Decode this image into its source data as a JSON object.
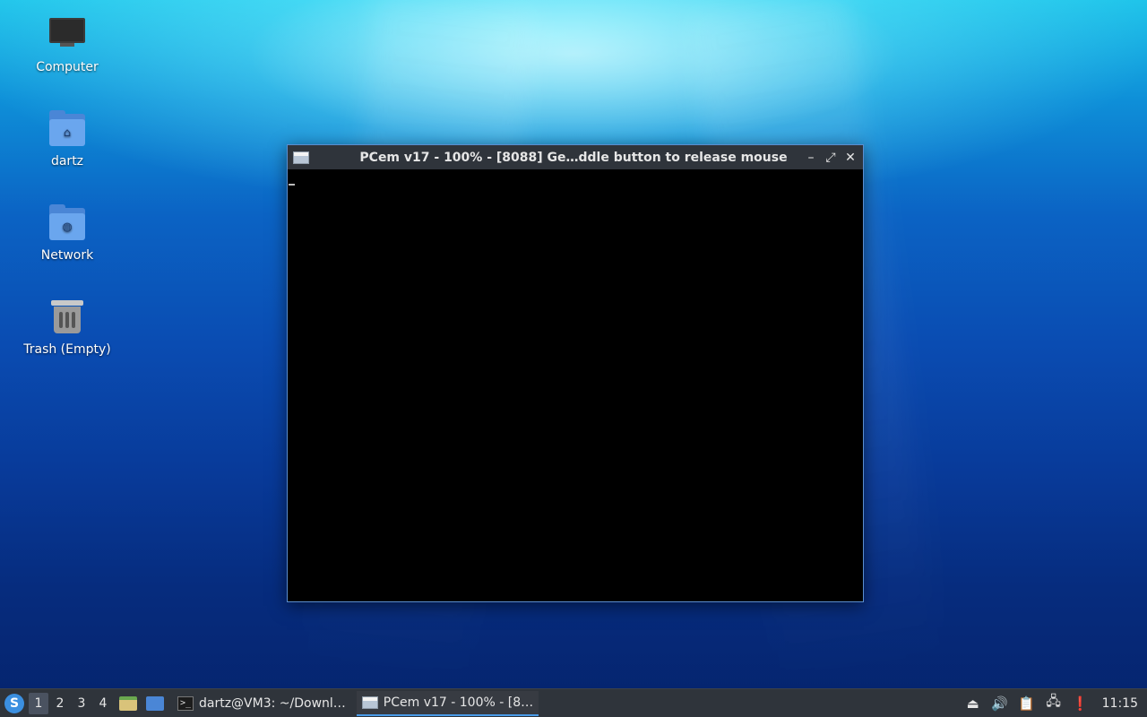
{
  "desktop": {
    "icons": [
      {
        "label": "Computer",
        "icon": "computer-icon"
      },
      {
        "label": "dartz",
        "icon": "home-folder-icon"
      },
      {
        "label": "Network",
        "icon": "network-folder-icon"
      },
      {
        "label": "Trash (Empty)",
        "icon": "trash-icon"
      }
    ]
  },
  "window": {
    "title": "PCem v17 - 100% - [8088] Ge…ddle button to release mouse",
    "minimize_glyph": "–",
    "maximize_glyph": "⤢",
    "close_glyph": "✕"
  },
  "taskbar": {
    "start_glyph": "S",
    "workspaces": [
      "1",
      "2",
      "3",
      "4"
    ],
    "active_workspace": "1",
    "tasks": [
      {
        "label": "dartz@VM3: ~/Downl…",
        "icon": "terminal-icon"
      },
      {
        "label": "PCem v17 - 100% - [8…",
        "icon": "pcem-icon"
      }
    ],
    "terminal_glyph": ">_",
    "tray": {
      "eject_glyph": "⏏",
      "volume_glyph": "🔊",
      "clipboard_glyph": "📋",
      "network_glyph": "🖧",
      "notification_glyph": "❗"
    },
    "clock": "11:15"
  }
}
